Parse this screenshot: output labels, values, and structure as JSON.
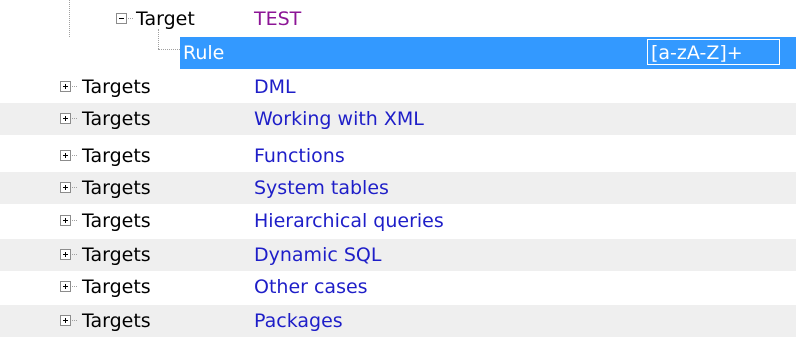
{
  "tree": {
    "expanded_node": {
      "kind": "Target",
      "name": "TEST",
      "expander": "minus"
    },
    "selected_child": {
      "kind": "Rule",
      "value": "[a-zA-Z]+"
    },
    "items": [
      {
        "kind": "Targets",
        "name": "DML",
        "expander": "plus"
      },
      {
        "kind": "Targets",
        "name": "Working with XML",
        "expander": "plus"
      },
      {
        "kind": "Targets",
        "name": "Functions",
        "expander": "plus"
      },
      {
        "kind": "Targets",
        "name": "System tables",
        "expander": "plus"
      },
      {
        "kind": "Targets",
        "name": "Hierarchical queries",
        "expander": "plus"
      },
      {
        "kind": "Targets",
        "name": "Dynamic SQL",
        "expander": "plus"
      },
      {
        "kind": "Targets",
        "name": "Other cases",
        "expander": "plus"
      },
      {
        "kind": "Targets",
        "name": "Packages",
        "expander": "plus"
      }
    ]
  },
  "colors": {
    "selection": "#3399ff",
    "alt_row": "#efefef",
    "name_text": "#1e1ec8",
    "root_name_text": "#8c1496"
  }
}
